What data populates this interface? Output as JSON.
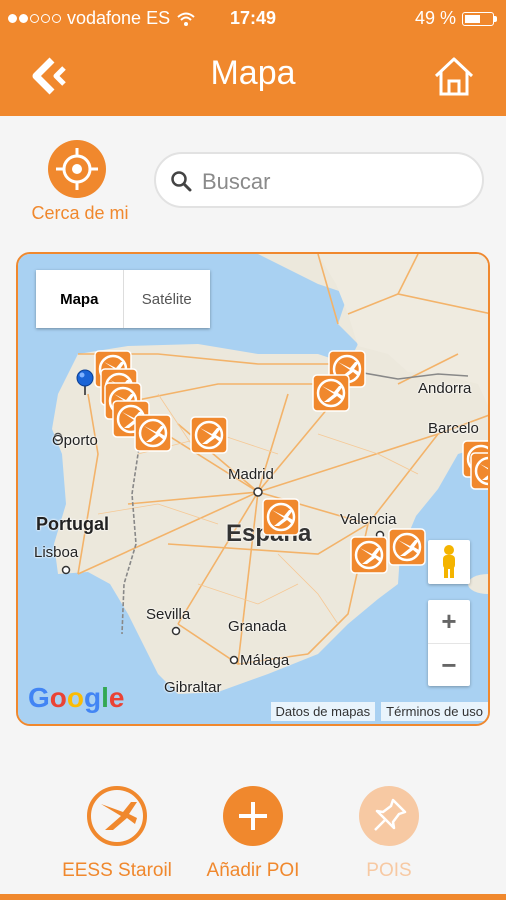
{
  "status_bar": {
    "carrier": "vodafone ES",
    "time": "17:49",
    "battery": "49 %",
    "battery_level": 0.49
  },
  "header": {
    "title": "Mapa",
    "back_icon": "back-chevron-icon",
    "home_icon": "home-icon"
  },
  "near_me": {
    "label": "Cerca de mi",
    "icon": "crosshair-icon"
  },
  "search": {
    "placeholder": "Buscar",
    "value": ""
  },
  "map": {
    "type_options": [
      "Mapa",
      "Satélite"
    ],
    "selected_type": "Mapa",
    "cities": [
      "Andorra",
      "Barcelo",
      "Oporto",
      "Madrid",
      "Valencia",
      "Lisboa",
      "Sevilla",
      "Granada",
      "Málaga",
      "Gibraltar"
    ],
    "countries": [
      "Portugal",
      "España"
    ],
    "logo": "Google",
    "attribution": [
      "Datos de mapas",
      "Términos de uso"
    ],
    "zoom_in": "+",
    "zoom_out": "−"
  },
  "bottom_nav": [
    {
      "label": "EESS Staroil",
      "icon": "fuel-station-icon",
      "enabled": true
    },
    {
      "label": "Añadir POI",
      "icon": "plus-icon",
      "enabled": true
    },
    {
      "label": "POIS",
      "icon": "pin-icon",
      "enabled": false
    }
  ],
  "colors": {
    "accent": "#f0882d",
    "accent_disabled": "#f7c9a3",
    "map_bg": "#e9e4d8",
    "sea": "#a9d1f2"
  }
}
